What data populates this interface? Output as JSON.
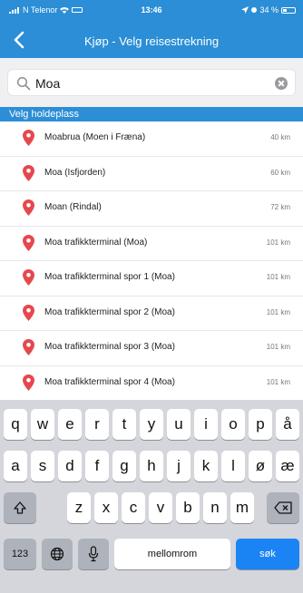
{
  "status_bar": {
    "carrier": "N Telenor",
    "time": "13:46",
    "battery": "34 %",
    "battery_level": 0.34
  },
  "header": {
    "title": "Kjøp - Velg reisestrekning"
  },
  "search": {
    "value": "Moa"
  },
  "section": {
    "title": "Velg holdeplass"
  },
  "results": [
    {
      "name": "Moabrua (Moen i Fræna)",
      "distance": "40 km"
    },
    {
      "name": "Moa (Isfjorden)",
      "distance": "60 km"
    },
    {
      "name": "Moan (Rindal)",
      "distance": "72 km"
    },
    {
      "name": "Moa trafikkterminal (Moa)",
      "distance": "101 km"
    },
    {
      "name": "Moa trafikkterminal spor 1 (Moa)",
      "distance": "101 km"
    },
    {
      "name": "Moa trafikkterminal spor 2 (Moa)",
      "distance": "101 km"
    },
    {
      "name": "Moa trafikkterminal spor 3 (Moa)",
      "distance": "101 km"
    },
    {
      "name": "Moa trafikkterminal spor 4 (Moa)",
      "distance": "101 km"
    },
    {
      "name": "",
      "distance": ""
    }
  ],
  "keyboard": {
    "row1": [
      "q",
      "w",
      "e",
      "r",
      "t",
      "y",
      "u",
      "i",
      "o",
      "p",
      "å"
    ],
    "row2": [
      "a",
      "s",
      "d",
      "f",
      "g",
      "h",
      "j",
      "k",
      "l",
      "ø",
      "æ"
    ],
    "row3": [
      "z",
      "x",
      "c",
      "v",
      "b",
      "n",
      "m"
    ],
    "numbers_label": "123",
    "space_label": "mellomrom",
    "go_label": "søk"
  },
  "colors": {
    "accent": "#2b8ed6",
    "pin": "#e5484d",
    "go_key": "#1a84f5"
  }
}
